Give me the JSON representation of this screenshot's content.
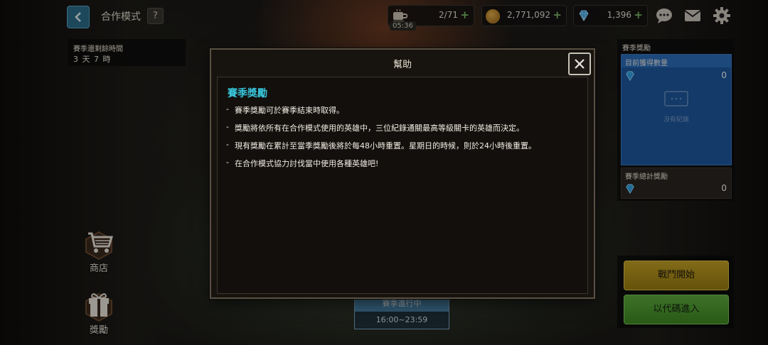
{
  "header": {
    "title": "合作模式",
    "help_label": "?",
    "stamina": "2/71",
    "stamina_timer": "05:36",
    "gold": "2,771,092",
    "gems": "1,396",
    "plus": "+"
  },
  "season_timer": {
    "label": "賽季還剩餘時間",
    "value": "3 天 7 時"
  },
  "sidebar": {
    "shop_label": "商店",
    "reward_label": "獎勵"
  },
  "reward_panel": {
    "title": "賽季獎勵",
    "current_label": "目前獲得數量",
    "current_value": "0",
    "empty_text": "沒有紀錄",
    "total_label": "賽季總計獎勵",
    "total_value": "0"
  },
  "actions": {
    "start_label": "戰鬥開始",
    "code_label": "以代碼進入"
  },
  "season_progress": {
    "status": "賽季進行中",
    "hours": "16:00~23:59"
  },
  "help_modal": {
    "title": "幫助",
    "heading": "賽季獎勵",
    "items": [
      "賽季獎勵可於賽季結束時取得。",
      "獎勵將依所有在合作模式使用的英雄中，三位紀錄通關最高等級關卡的英雄而決定。",
      "現有獎勵在累計至當季獎勵後將於每48小時重置。星期日的時候，則於24小時後重置。",
      "在合作模式協力討伐當中使用各種英雄吧!"
    ]
  },
  "colors": {
    "accent_cyan": "#39c3d8",
    "start_button": "#c7a526",
    "code_button": "#5fae3e",
    "reward_blue": "#1e59a0"
  }
}
